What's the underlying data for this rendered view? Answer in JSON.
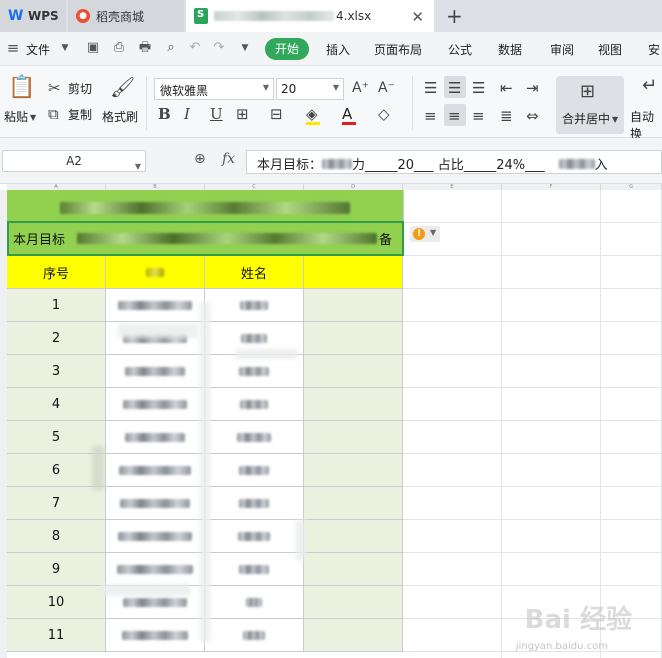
{
  "tabs": {
    "wps": "WPS",
    "daoke": "稻壳商城",
    "file_suffix": "4.xlsx"
  },
  "menu": {
    "file": "文件",
    "items": [
      "开始",
      "插入",
      "页面布局",
      "公式",
      "数据",
      "审阅",
      "视图",
      "安"
    ]
  },
  "ribbon": {
    "paste": "粘贴",
    "cut": "剪切",
    "copy": "复制",
    "format_painter": "格式刷",
    "font_name": "微软雅黑",
    "font_size": "20",
    "merge_center": "合并居中",
    "auto_wrap": "自动换"
  },
  "formula_bar": {
    "cell_ref": "A2",
    "fx": "fx",
    "content_prefix": "本月目标：",
    "content_mid": "力_____20___ 占比_____24%___",
    "content_suffix": "入"
  },
  "sheet": {
    "col_headers": [
      "A",
      "B",
      "C",
      "D",
      "E",
      "F",
      "G"
    ],
    "row2_text": "本月目标",
    "row2_tail": "备",
    "header_seq": "序号",
    "header_name": "姓名",
    "rows": [
      "1",
      "2",
      "3",
      "4",
      "5",
      "6",
      "7",
      "8",
      "9",
      "10",
      "11"
    ]
  },
  "watermark": {
    "brand": "Bai 经验",
    "url": "jingyan.baidu.com"
  },
  "colors": {
    "title_green": "#92d050",
    "header_yellow": "#ffff00",
    "data_pale": "#ebf1de",
    "accent_green": "#31a85b"
  }
}
